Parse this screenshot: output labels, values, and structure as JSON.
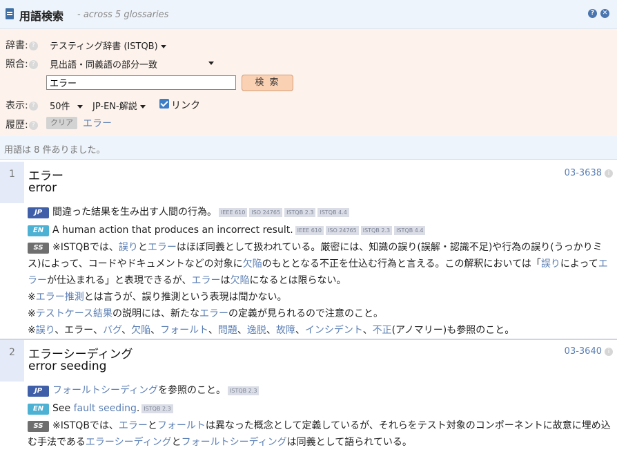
{
  "header": {
    "title": "用語検索",
    "subtitle": "- across 5 glossaries"
  },
  "form": {
    "dict_label": "辞書:",
    "dict_value": "テスティング辞書 (ISTQB)",
    "match_label": "照合:",
    "match_value": "見出語・同義語の部分一致",
    "search_value": "エラー",
    "search_button": "検 索",
    "display_label": "表示:",
    "count_value": "50件",
    "mode_value": "JP-EN-解説",
    "link_label": "リンク",
    "history_label": "履歴:",
    "clear_button": "クリア",
    "history_item": "エラー"
  },
  "result_count": "用語は 8 件ありました。",
  "entries": [
    {
      "num": "1",
      "ja": "エラー",
      "en": "error",
      "id": "03-3638",
      "jp_text": "間違った結果を生み出す人間の行為。",
      "jp_refs": [
        "IEEE 610",
        "ISO 24765",
        "ISTQB 2.3",
        "ISTQB 4.4"
      ],
      "en_text": "A human action that produces an incorrect result.",
      "en_refs": [
        "IEEE 610",
        "ISO 24765",
        "ISTQB 2.3",
        "ISTQB 4.4"
      ]
    },
    {
      "num": "2",
      "ja": "エラーシーディング",
      "en": "error seeding",
      "id": "03-3640",
      "jp_refs": [
        "ISTQB 2.3"
      ],
      "en_refs": [
        "ISTQB 2.3"
      ]
    }
  ],
  "tags": {
    "jp": "JP",
    "en": "EN",
    "ss": "SS"
  },
  "icons": {
    "header": "book-icon",
    "help": "question-icon",
    "close": "close-icon"
  },
  "colors": {
    "accent": "#3f5fa8",
    "link": "#5b7fb4",
    "button": "#fbd1b4"
  }
}
